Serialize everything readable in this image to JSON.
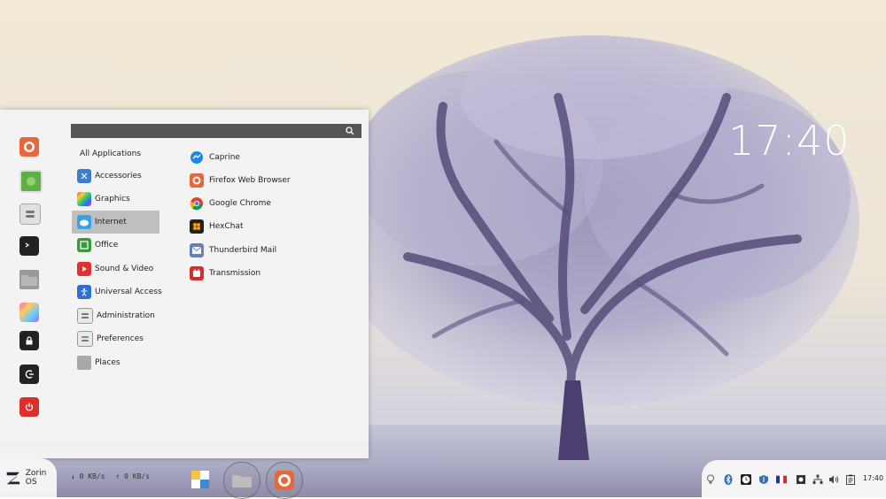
{
  "desktop": {
    "clock": "17:40"
  },
  "menu": {
    "search": {
      "value": "",
      "placeholder": ""
    },
    "all_applications_label": "All Applications",
    "favorites": [
      {
        "name": "firefox-icon"
      },
      {
        "name": "software-center-icon"
      },
      {
        "name": "settings-icon"
      },
      {
        "name": "terminal-icon"
      },
      {
        "name": "files-icon"
      },
      {
        "name": "appearance-icon"
      },
      {
        "name": "lock-icon"
      },
      {
        "name": "logout-icon"
      },
      {
        "name": "power-icon"
      }
    ],
    "categories": [
      {
        "label": "Accessories",
        "icon": "accessories-icon"
      },
      {
        "label": "Graphics",
        "icon": "graphics-icon"
      },
      {
        "label": "Internet",
        "icon": "internet-icon",
        "selected": true
      },
      {
        "label": "Office",
        "icon": "office-icon"
      },
      {
        "label": "Sound & Video",
        "icon": "sound-video-icon"
      },
      {
        "label": "Universal Access",
        "icon": "universal-access-icon"
      },
      {
        "label": "Administration",
        "icon": "administration-icon"
      },
      {
        "label": "Preferences",
        "icon": "preferences-icon"
      },
      {
        "label": "Places",
        "icon": "places-icon"
      }
    ],
    "apps": [
      {
        "label": "Caprine",
        "icon": "caprine-icon"
      },
      {
        "label": "Firefox Web Browser",
        "icon": "firefox-icon"
      },
      {
        "label": "Google Chrome",
        "icon": "chrome-icon"
      },
      {
        "label": "HexChat",
        "icon": "hexchat-icon"
      },
      {
        "label": "Thunderbird Mail",
        "icon": "thunderbird-icon"
      },
      {
        "label": "Transmission",
        "icon": "transmission-icon"
      }
    ]
  },
  "taskbar": {
    "start_label": "Zorin OS",
    "net_down": "↓ 0 KB/s",
    "net_up": "↑ 0 KB/s",
    "tray_time": "17:40",
    "colors": {
      "accent": "#e8663b",
      "power": "#d9302c"
    }
  }
}
